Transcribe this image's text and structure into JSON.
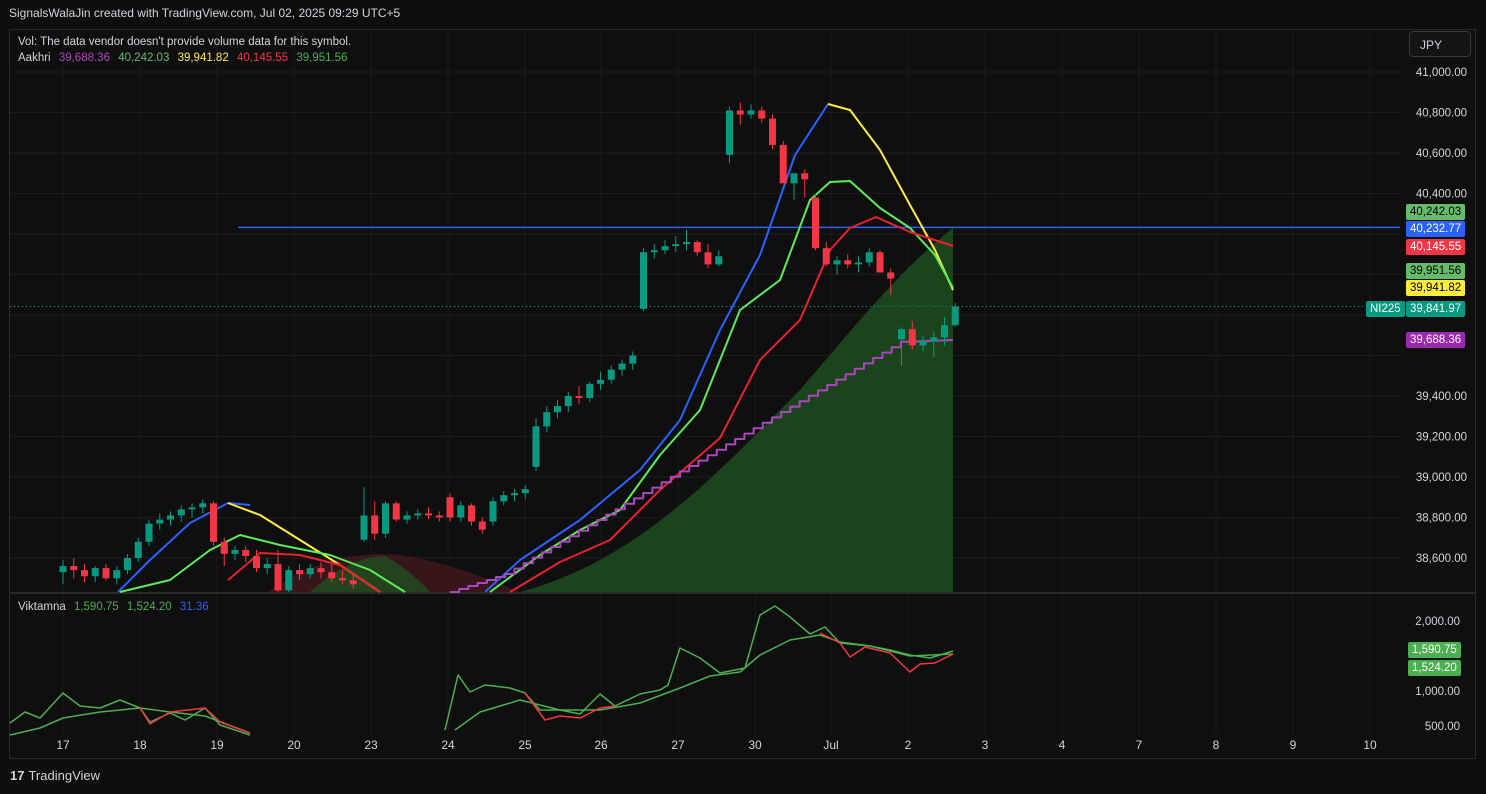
{
  "header": {
    "credit": "SignalsWalaJin created with TradingView.com, Jul 02, 2025 09:29 UTC+5"
  },
  "footer": {
    "brand": "TradingView",
    "logo_text": "17"
  },
  "legend": {
    "volume_note": "Vol: The data vendor doesn't provide volume data for this symbol.",
    "indicator_name": "Aakhri",
    "indicator_values": [
      "39,688.36",
      "40,242.03",
      "39,941.82",
      "40,145.55",
      "39,951.56"
    ],
    "indicator_colors": [
      "#ab47bc",
      "#66bb6a",
      "#ffeb3b",
      "#f23645",
      "#4caf50"
    ],
    "oscillator_name": "Viktamna",
    "oscillator_values": [
      "1,590.75",
      "1,524.20",
      "31.36"
    ],
    "oscillator_colors": [
      "#4caf50",
      "#4caf50",
      "#2962ff"
    ]
  },
  "currency_button": {
    "label": "JPY"
  },
  "colors": {
    "up_candle": "#089981",
    "down_candle": "#f23645",
    "blue_line": "#2962ff",
    "horizontal_level": "#2962ff",
    "green_line": "#5bec5b",
    "red_line": "#e8212f",
    "purple_step": "#ab47bc",
    "yellow_segment": "#ffeb3b",
    "cloud_green": "#1f4d1f",
    "cloud_red": "#5a1e22",
    "osc_green": "#4caf50",
    "osc_red": "#f23645"
  },
  "chart_data": {
    "type": "candlestick",
    "symbol": "NI225",
    "price_axis": {
      "ticks": [
        "41,000.00",
        "40,800.00",
        "40,600.00",
        "40,400.00",
        "39,400.00",
        "39,200.00",
        "39,000.00",
        "38,800.00",
        "38,600.00"
      ],
      "range": [
        38430,
        41120
      ]
    },
    "time_axis": {
      "ticks": [
        "17",
        "18",
        "19",
        "20",
        "23",
        "24",
        "25",
        "26",
        "27",
        "30",
        "Jul",
        "2",
        "3",
        "4",
        "7",
        "8",
        "9",
        "10"
      ]
    },
    "horizontal_level": 40232.77,
    "last_price": 39841.97,
    "price_labels": [
      {
        "text": "40,242.03",
        "value": 40242.03,
        "color": "#66bb6a"
      },
      {
        "text": "40,232.77",
        "value": 40232.77,
        "color": "#2962ff"
      },
      {
        "text": "40,145.55",
        "value": 40145.55,
        "color": "#f23645"
      },
      {
        "text": "39,951.56",
        "value": 39951.56,
        "color": "#66bb6a"
      },
      {
        "text": "39,941.82",
        "value": 39941.82,
        "color": "#ffeb3b"
      },
      {
        "text": "39,841.97",
        "value": 39841.97,
        "color": "#089981"
      },
      {
        "text": "39,688.36",
        "value": 39688.36,
        "color": "#9c27b0"
      }
    ],
    "symbol_badge": "NI225",
    "candles_ohlc": [
      [
        38530,
        38590,
        38470,
        38560
      ],
      [
        38560,
        38600,
        38500,
        38540
      ],
      [
        38540,
        38570,
        38480,
        38510
      ],
      [
        38510,
        38560,
        38480,
        38550
      ],
      [
        38550,
        38570,
        38490,
        38500
      ],
      [
        38500,
        38560,
        38470,
        38540
      ],
      [
        38540,
        38620,
        38520,
        38600
      ],
      [
        38600,
        38700,
        38580,
        38680
      ],
      [
        38680,
        38790,
        38660,
        38770
      ],
      [
        38770,
        38820,
        38740,
        38790
      ],
      [
        38790,
        38830,
        38760,
        38810
      ],
      [
        38810,
        38860,
        38780,
        38840
      ],
      [
        38840,
        38870,
        38800,
        38850
      ],
      [
        38850,
        38890,
        38820,
        38870
      ],
      [
        38870,
        38880,
        38660,
        38680
      ],
      [
        38680,
        38700,
        38560,
        38620
      ],
      [
        38620,
        38660,
        38590,
        38640
      ],
      [
        38640,
        38660,
        38580,
        38610
      ],
      [
        38610,
        38640,
        38530,
        38550
      ],
      [
        38550,
        38600,
        38520,
        38570
      ],
      [
        38570,
        38640,
        38400,
        38440
      ],
      [
        38440,
        38560,
        38420,
        38540
      ],
      [
        38540,
        38570,
        38490,
        38520
      ],
      [
        38520,
        38570,
        38500,
        38550
      ],
      [
        38550,
        38580,
        38500,
        38530
      ],
      [
        38530,
        38570,
        38480,
        38500
      ],
      [
        38500,
        38540,
        38470,
        38490
      ],
      [
        38490,
        38530,
        38450,
        38470
      ],
      [
        38690,
        38950,
        38680,
        38810
      ],
      [
        38810,
        38880,
        38690,
        38720
      ],
      [
        38720,
        38880,
        38700,
        38870
      ],
      [
        38870,
        38880,
        38780,
        38790
      ],
      [
        38790,
        38830,
        38770,
        38810
      ],
      [
        38810,
        38840,
        38790,
        38820
      ],
      [
        38820,
        38850,
        38790,
        38810
      ],
      [
        38810,
        38830,
        38780,
        38800
      ],
      [
        38900,
        38920,
        38780,
        38800
      ],
      [
        38800,
        38880,
        38780,
        38860
      ],
      [
        38860,
        38870,
        38760,
        38780
      ],
      [
        38780,
        38800,
        38720,
        38740
      ],
      [
        38780,
        38900,
        38760,
        38880
      ],
      [
        38880,
        38930,
        38860,
        38910
      ],
      [
        38910,
        38940,
        38880,
        38920
      ],
      [
        38920,
        38960,
        38890,
        38940
      ],
      [
        39050,
        39290,
        39030,
        39250
      ],
      [
        39250,
        39350,
        39220,
        39320
      ],
      [
        39320,
        39380,
        39290,
        39350
      ],
      [
        39350,
        39420,
        39320,
        39400
      ],
      [
        39400,
        39450,
        39360,
        39390
      ],
      [
        39390,
        39470,
        39370,
        39460
      ],
      [
        39460,
        39520,
        39430,
        39480
      ],
      [
        39480,
        39550,
        39460,
        39530
      ],
      [
        39530,
        39580,
        39500,
        39560
      ],
      [
        39560,
        39620,
        39530,
        39600
      ],
      [
        39830,
        40130,
        39820,
        40110
      ],
      [
        40110,
        40150,
        40080,
        40120
      ],
      [
        40120,
        40170,
        40100,
        40140
      ],
      [
        40140,
        40190,
        40110,
        40150
      ],
      [
        40150,
        40220,
        40120,
        40160
      ],
      [
        40160,
        40170,
        40090,
        40110
      ],
      [
        40110,
        40150,
        40030,
        40050
      ],
      [
        40050,
        40120,
        40040,
        40090
      ],
      [
        40590,
        40830,
        40550,
        40810
      ],
      [
        40810,
        40850,
        40740,
        40790
      ],
      [
        40790,
        40840,
        40770,
        40810
      ],
      [
        40810,
        40830,
        40750,
        40770
      ],
      [
        40770,
        40790,
        40620,
        40640
      ],
      [
        40640,
        40660,
        40470,
        40450
      ],
      [
        40450,
        40480,
        40370,
        40500
      ],
      [
        40500,
        40520,
        40380,
        40470
      ],
      [
        40380,
        40400,
        40120,
        40130
      ],
      [
        40130,
        40160,
        40040,
        40050
      ],
      [
        40050,
        40090,
        40000,
        40070
      ],
      [
        40070,
        40100,
        40030,
        40050
      ],
      [
        40050,
        40090,
        40010,
        40060
      ],
      [
        40060,
        40130,
        40040,
        40110
      ],
      [
        40110,
        40120,
        40040,
        40010
      ],
      [
        40010,
        40030,
        39900,
        39980
      ],
      [
        39680,
        39740,
        39550,
        39730
      ],
      [
        39730,
        39770,
        39630,
        39650
      ],
      [
        39650,
        39700,
        39620,
        39670
      ],
      [
        39670,
        39720,
        39590,
        39690
      ],
      [
        39690,
        39790,
        39650,
        39750
      ],
      [
        39750,
        39860,
        39740,
        39842
      ]
    ],
    "oscillator_axis": {
      "ticks": [
        "2,000.00",
        "1,000.00",
        "500.00"
      ]
    },
    "oscillator_labels": [
      {
        "text": "1,590.75",
        "value": 1590.75,
        "color": "#4caf50"
      },
      {
        "text": "1,524.20",
        "value": 1524.2,
        "color": "#4caf50"
      }
    ]
  }
}
